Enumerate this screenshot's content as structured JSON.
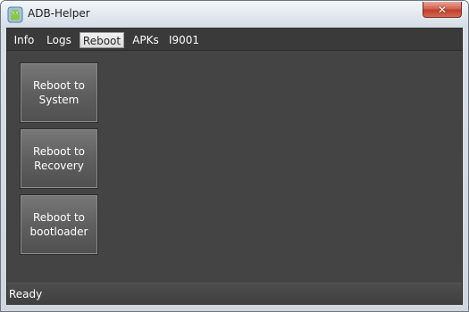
{
  "window": {
    "title": "ADB-Helper",
    "close_glyph": "✕"
  },
  "tabs": [
    {
      "label": "Info",
      "active": false
    },
    {
      "label": "Logs",
      "active": false
    },
    {
      "label": "Reboot",
      "active": true
    },
    {
      "label": "APKs",
      "active": false
    },
    {
      "label": "I9001",
      "active": false
    }
  ],
  "reboot_panel": {
    "buttons": [
      {
        "label": "Reboot to System"
      },
      {
        "label": "Reboot to Recovery"
      },
      {
        "label": "Reboot to bootloader"
      }
    ]
  },
  "status": {
    "text": "Ready"
  },
  "icons": {
    "app": "android-robot-icon",
    "close": "close-icon"
  }
}
